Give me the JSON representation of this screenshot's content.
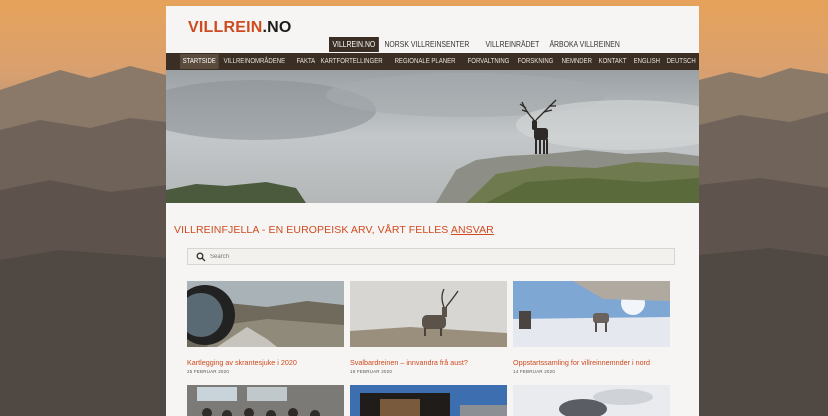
{
  "site": {
    "logo_part1": "VILLREIN",
    "logo_part2": ".NO"
  },
  "topnav": [
    {
      "label": "VILLREIN.NO",
      "active": true
    },
    {
      "label": "NORSK VILLREINSENTER",
      "active": false
    },
    {
      "label": "VILLREINRÅDET",
      "active": false
    },
    {
      "label": "ÅRBOKA VILLREINEN",
      "active": false
    }
  ],
  "mainnav": [
    {
      "label": "STARTSIDE",
      "active": true
    },
    {
      "label": "VILLREINOMRÅDENE",
      "active": false
    },
    {
      "label": "FAKTA",
      "active": false
    },
    {
      "label": "KARTFORTELLINGER",
      "active": false
    },
    {
      "label": "REGIONALE PLANER",
      "active": false
    },
    {
      "label": "FORVALTNING",
      "active": false
    },
    {
      "label": "FORSKNING",
      "active": false
    },
    {
      "label": "NEMNDER",
      "active": false
    },
    {
      "label": "KONTAKT",
      "active": false
    },
    {
      "label": "ENGLISH",
      "active": false
    },
    {
      "label": "DEUTSCH",
      "active": false
    }
  ],
  "main": {
    "heading_text": "VILLREINFJELLA - EN EUROPEISK ARV, VÅRT FELLES ",
    "heading_link": "ANSVAR",
    "search_placeholder": "Search"
  },
  "articles": [
    {
      "title": "Kartlegging av skrantesjuke i 2020",
      "date": "25 FEBRUAR 2020"
    },
    {
      "title": "Svalbardreinen – innvandra frå aust?",
      "date": "19 FEBRUAR 2020"
    },
    {
      "title": "Oppstartssamling for villreinnemnder i nord",
      "date": "14 FEBRUAR 2020"
    }
  ],
  "colors": {
    "accent": "#cf4a1f",
    "nav_bg": "#3b2f25"
  }
}
